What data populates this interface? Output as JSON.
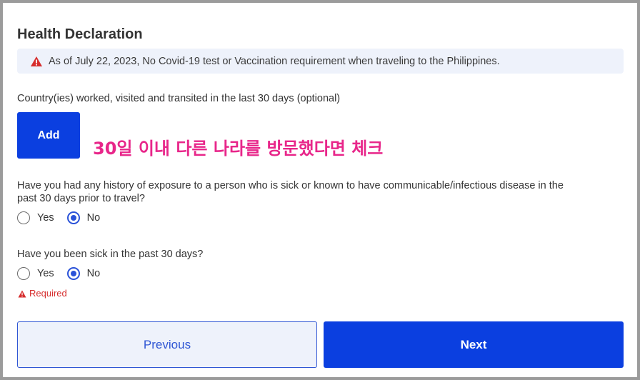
{
  "form": {
    "title": "Health Declaration",
    "alert_text": "As of July 22, 2023, No Covid-19 test or Vaccination requirement when traveling to the Philippines.",
    "countries_label": "Country(ies) worked, visited and transited in the last 30 days (optional)",
    "add_label": "Add",
    "annotation": "30일 이내 다른 나라를 방문했다면 체크",
    "exposure_question_line1": "Have you had any history of exposure to a person who is sick or known to have communicable/infectious disease in the",
    "exposure_question_line2": "past 30 days prior to travel?",
    "exposure_options": [
      {
        "label": "Yes",
        "checked": false
      },
      {
        "label": "No",
        "checked": true
      }
    ],
    "sick_question": "Have you been sick in the past 30 days?",
    "sick_options": [
      {
        "label": "Yes",
        "checked": false
      },
      {
        "label": "No",
        "checked": true
      }
    ],
    "required_text": "Required",
    "previous_label": "Previous",
    "next_label": "Next"
  },
  "colors": {
    "primary": "#0b3fe0",
    "annotation": "#e8268a",
    "alert_bg": "#eef2fb",
    "warning": "#d62d2d"
  },
  "icons": {
    "alert": "warning-triangle-icon",
    "required": "warning-triangle-icon"
  }
}
